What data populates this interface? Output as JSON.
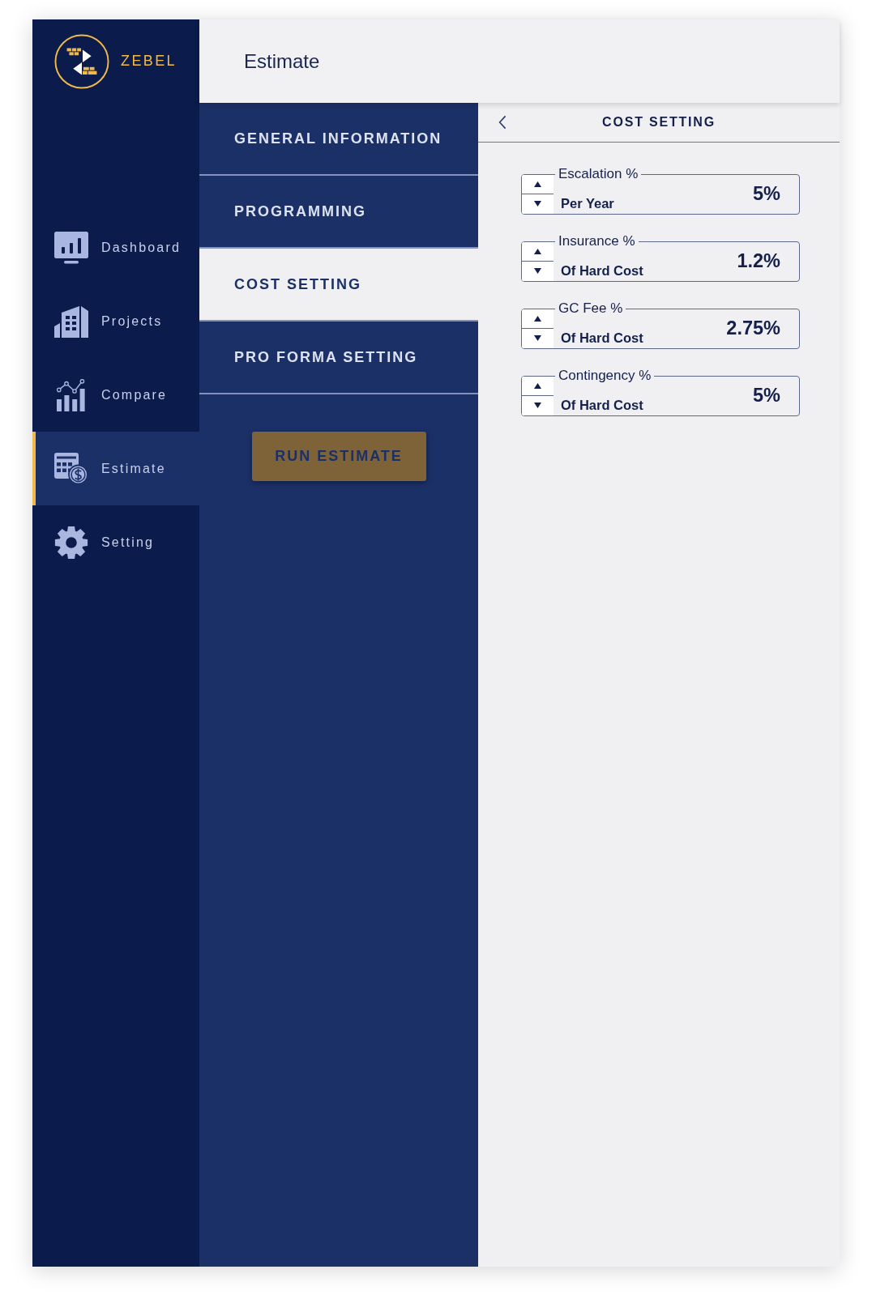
{
  "sidebar": {
    "logo_text": "ZEBEL",
    "items": [
      {
        "kind": "dashboard",
        "label": "Dashboard",
        "selected": false
      },
      {
        "kind": "projects",
        "label": "Projects",
        "selected": false
      },
      {
        "kind": "compare",
        "label": "Compare",
        "selected": false
      },
      {
        "kind": "estimate",
        "label": "Estimate",
        "selected": true
      },
      {
        "kind": "setting",
        "label": "Setting",
        "selected": false
      }
    ]
  },
  "header": {
    "title": "Estimate"
  },
  "sections": {
    "items": [
      {
        "label": "GENERAL INFORMATION",
        "selected": false
      },
      {
        "label": "PROGRAMMING",
        "selected": false
      },
      {
        "label": "COST SETTING",
        "selected": true
      },
      {
        "label": "PRO FORMA SETTING",
        "selected": false
      }
    ],
    "run_button": {
      "label": "RUN ESTIMATE"
    }
  },
  "panel": {
    "title": "COST SETTING",
    "fields": [
      {
        "label": "Escalation %",
        "unit": "Per Year",
        "value": "5%"
      },
      {
        "label": "Insurance %",
        "unit": "Of Hard Cost",
        "value": "1.2%"
      },
      {
        "label": "GC Fee %",
        "unit": "Of Hard Cost",
        "value": "2.75%"
      },
      {
        "label": "Contingency %",
        "unit": "Of Hard Cost",
        "value": "5%"
      }
    ]
  }
}
